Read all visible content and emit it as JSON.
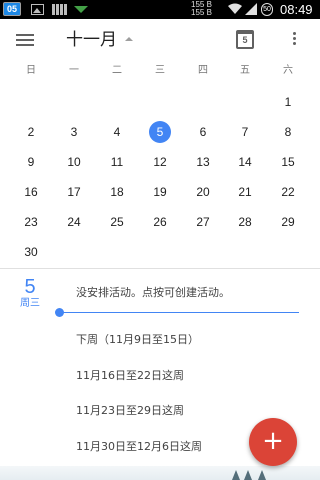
{
  "status_bar": {
    "badge": "05",
    "rate_up": "155 B",
    "rate_down": "155 B",
    "battery": "50",
    "time": "08:49",
    "icons": [
      "image-icon",
      "grid-icon",
      "download-icon",
      "wifi-icon",
      "signal-icon",
      "battery-icon"
    ]
  },
  "app_bar": {
    "month_title": "十一月",
    "today_number": "5",
    "icons": [
      "menu-icon",
      "dropdown-caret-icon",
      "today-calendar-icon",
      "more-vert-icon"
    ]
  },
  "calendar": {
    "weekdays": [
      "日",
      "一",
      "二",
      "三",
      "四",
      "五",
      "六"
    ],
    "weeks": [
      [
        "",
        "",
        "",
        "",
        "",
        "",
        "1"
      ],
      [
        "2",
        "3",
        "4",
        "5",
        "6",
        "7",
        "8"
      ],
      [
        "9",
        "10",
        "11",
        "12",
        "13",
        "14",
        "15"
      ],
      [
        "16",
        "17",
        "18",
        "19",
        "20",
        "21",
        "22"
      ],
      [
        "23",
        "24",
        "25",
        "26",
        "27",
        "28",
        "29"
      ],
      [
        "30",
        "",
        "",
        "",
        "",
        "",
        ""
      ]
    ],
    "selected_day": "5"
  },
  "agenda": {
    "date": "5",
    "weekday": "周三",
    "no_events_text": "没安排活动。点按可创建活动。",
    "weeks": [
      "下周（11月9日至15日）",
      "11月16日至22日这周",
      "11月23日至29日这周",
      "11月30日至12月6日这周"
    ]
  },
  "fab": {
    "label": "+"
  },
  "colors": {
    "accent": "#4285f4",
    "fab": "#db4437",
    "status_bar": "#000000"
  }
}
